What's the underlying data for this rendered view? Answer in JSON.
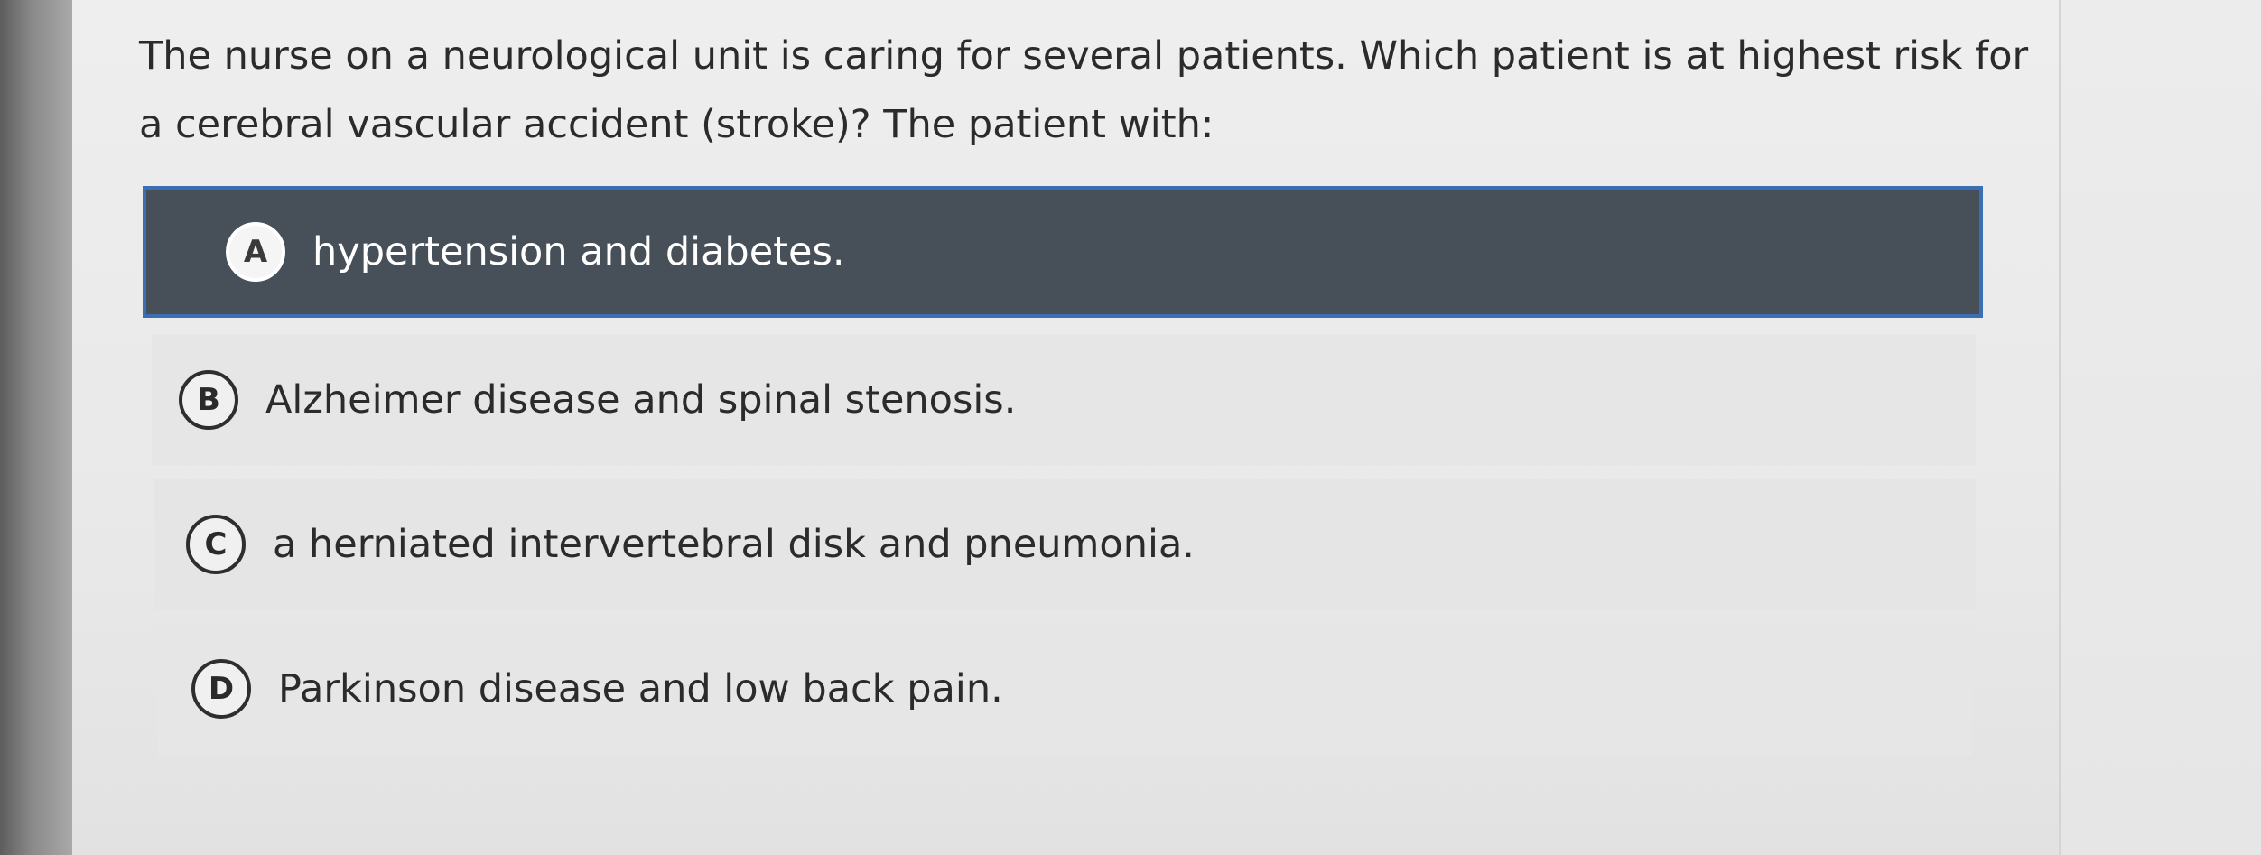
{
  "question": {
    "text": "The nurse on a neurological unit is caring for several patients. Which patient is at highest risk for a cerebral vascular accident (stroke)? The patient with:"
  },
  "options": [
    {
      "letter": "A",
      "text": "hypertension and diabetes.",
      "selected": true
    },
    {
      "letter": "B",
      "text": "Alzheimer disease and spinal stenosis.",
      "selected": false
    },
    {
      "letter": "C",
      "text": "a herniated intervertebral disk and pneumonia.",
      "selected": false
    },
    {
      "letter": "D",
      "text": "Parkinson disease and low back pain.",
      "selected": false
    }
  ],
  "colors": {
    "selected_background": "#474f58",
    "selected_border": "#3a6fb4",
    "option_background": "#e4e4e4",
    "text": "#2b2b2b"
  }
}
